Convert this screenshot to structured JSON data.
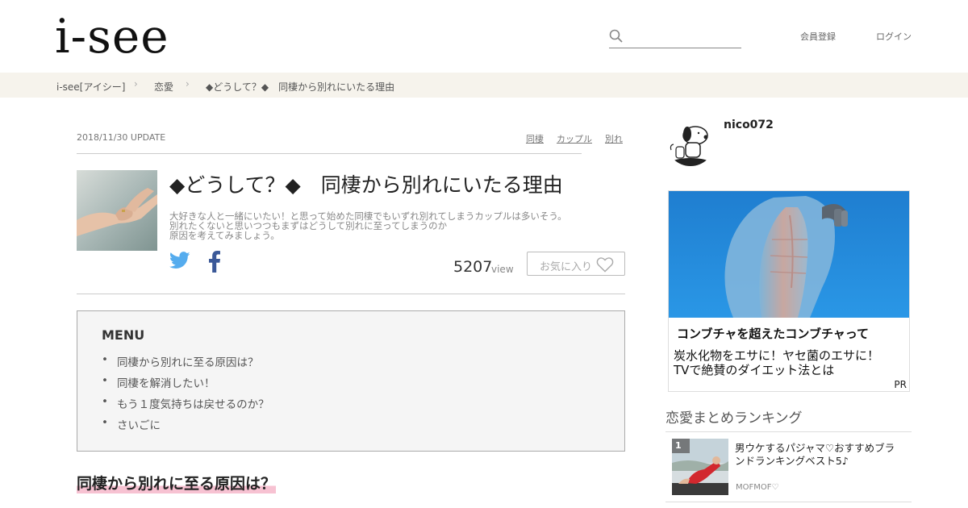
{
  "header": {
    "logo": "i-see",
    "search_placeholder": "",
    "register": "会員登録",
    "login": "ログイン"
  },
  "breadcrumb": {
    "items": [
      "i-see[アイシー]",
      "恋愛",
      "◆どうして？◆　同棲から別れにいたる理由"
    ],
    "separator": "›"
  },
  "article": {
    "date": "2018/11/30 UPDATE",
    "tags": [
      "同棲",
      "カップル",
      "別れ"
    ],
    "title": "◆どうして？◆　同棲から別れにいたる理由",
    "lead_lines": [
      "大好きな人と一緒にいたい！と思って始めた同棲でもいずれ別れてしまうカップルは多いそう。",
      "別れたくないと思いつつもまずはどうして別れに至ってしまうのか",
      "原因を考えてみましょう。"
    ],
    "views": "5207",
    "views_unit": "view",
    "favorite_label": "お気に入り"
  },
  "menu": {
    "title": "MENU",
    "bullet": "•",
    "items": [
      "同棲から別れに至る原因は？",
      "同棲を解消したい！",
      "もう１度気持ちは戻せるのか？",
      "さいごに"
    ]
  },
  "section": {
    "title": "同棲から別れに至る原因は？"
  },
  "sidebar": {
    "author": "nico072",
    "ad": {
      "headline": "コンブチャを超えたコンブチャって",
      "body_lines": [
        "炭水化物をエサに！ヤセ菌のエサに！",
        "TVで絶賛のダイエット法とは"
      ],
      "pr": "PR"
    },
    "ranking": {
      "title": "恋愛まとめランキング",
      "items": [
        {
          "rank": "1",
          "title_lines": [
            "男ウケするパジャマ♡おすすめブラ",
            "ンドランキングベスト5♪"
          ],
          "source": "MOFMOF♡"
        }
      ]
    }
  },
  "colors": {
    "breadcrumb_bg": "#f6f3ec",
    "twitter": "#55acee",
    "facebook": "#3b5998",
    "highlight": "#f7c2d2",
    "menu_bg": "#f5f5f5"
  }
}
